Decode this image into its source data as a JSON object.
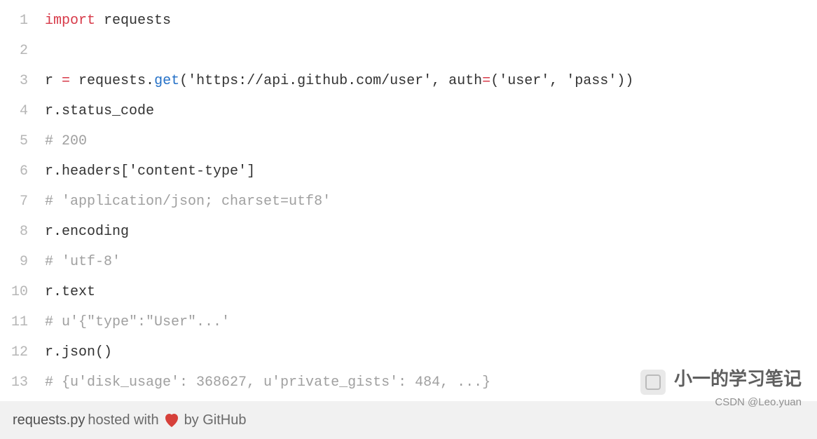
{
  "code": {
    "lines": [
      {
        "n": "1",
        "tokens": [
          {
            "t": "import",
            "c": "kw"
          },
          {
            "t": " requests",
            "c": ""
          }
        ]
      },
      {
        "n": "2",
        "tokens": [
          {
            "t": "",
            "c": ""
          }
        ]
      },
      {
        "n": "3",
        "tokens": [
          {
            "t": "r ",
            "c": ""
          },
          {
            "t": "=",
            "c": "kw"
          },
          {
            "t": " requests.",
            "c": ""
          },
          {
            "t": "get",
            "c": "fn"
          },
          {
            "t": "(",
            "c": ""
          },
          {
            "t": "'https://api.github.com/user'",
            "c": "str"
          },
          {
            "t": ", auth",
            "c": ""
          },
          {
            "t": "=",
            "c": "kw"
          },
          {
            "t": "(",
            "c": ""
          },
          {
            "t": "'user'",
            "c": "str"
          },
          {
            "t": ", ",
            "c": ""
          },
          {
            "t": "'pass'",
            "c": "str"
          },
          {
            "t": "))",
            "c": ""
          }
        ]
      },
      {
        "n": "4",
        "tokens": [
          {
            "t": "r.status_code",
            "c": ""
          }
        ]
      },
      {
        "n": "5",
        "tokens": [
          {
            "t": "# 200",
            "c": "cmt"
          }
        ]
      },
      {
        "n": "6",
        "tokens": [
          {
            "t": "r.headers[",
            "c": ""
          },
          {
            "t": "'content-type'",
            "c": "str"
          },
          {
            "t": "]",
            "c": ""
          }
        ]
      },
      {
        "n": "7",
        "tokens": [
          {
            "t": "# 'application/json; charset=utf8'",
            "c": "cmt"
          }
        ]
      },
      {
        "n": "8",
        "tokens": [
          {
            "t": "r.encoding",
            "c": ""
          }
        ]
      },
      {
        "n": "9",
        "tokens": [
          {
            "t": "# 'utf-8'",
            "c": "cmt"
          }
        ]
      },
      {
        "n": "10",
        "tokens": [
          {
            "t": "r.text",
            "c": ""
          }
        ]
      },
      {
        "n": "11",
        "tokens": [
          {
            "t": "# u'{\"type\":\"User\"...'",
            "c": "cmt"
          }
        ]
      },
      {
        "n": "12",
        "tokens": [
          {
            "t": "r.json()",
            "c": ""
          }
        ]
      },
      {
        "n": "13",
        "tokens": [
          {
            "t": "# {u'disk_usage': 368627, u'private_gists': 484, ...}",
            "c": "cmt"
          }
        ]
      }
    ]
  },
  "footer": {
    "filename": "requests.py",
    "hosted": " hosted with ",
    "by": " by GitHub"
  },
  "watermark": {
    "title": "小一的学习笔记",
    "sub": "CSDN @Leo.yuan"
  },
  "icons": {
    "heart": "heart-icon",
    "wechat": "wechat-icon"
  }
}
